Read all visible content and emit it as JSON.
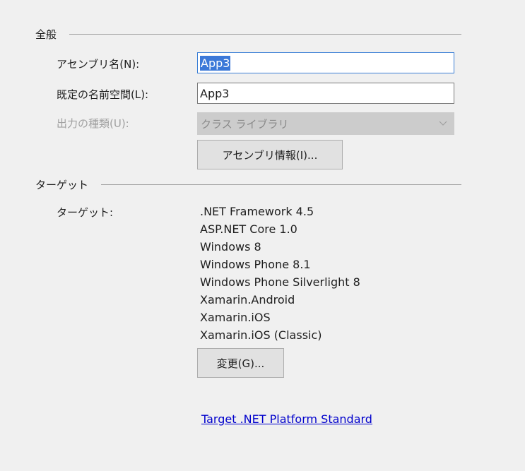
{
  "general": {
    "section_title": "全般",
    "assembly_name_label": "アセンブリ名(N):",
    "assembly_name_value": "App3",
    "default_namespace_label": "既定の名前空間(L):",
    "default_namespace_value": "App3",
    "output_type_label": "出力の種類(U):",
    "output_type_value": "クラス ライブラリ",
    "assembly_info_button": "アセンブリ情報(I)..."
  },
  "target": {
    "section_title": "ターゲット",
    "targets_label": "ターゲット:",
    "targets": [
      ".NET Framework 4.5",
      "ASP.NET Core 1.0",
      "Windows 8",
      "Windows Phone 8.1",
      "Windows Phone Silverlight 8",
      "Xamarin.Android",
      "Xamarin.iOS",
      "Xamarin.iOS (Classic)"
    ],
    "change_button": "変更(G)...",
    "platform_standard_link": "Target .NET Platform Standard"
  },
  "colors": {
    "background": "#f0f0f0",
    "selection": "#3b78d8",
    "focus_border": "#3a7fd6",
    "link": "#0000cc",
    "disabled_text": "#a0a0a0"
  },
  "icons": {
    "combobox_arrow": "chevron-down-icon"
  }
}
